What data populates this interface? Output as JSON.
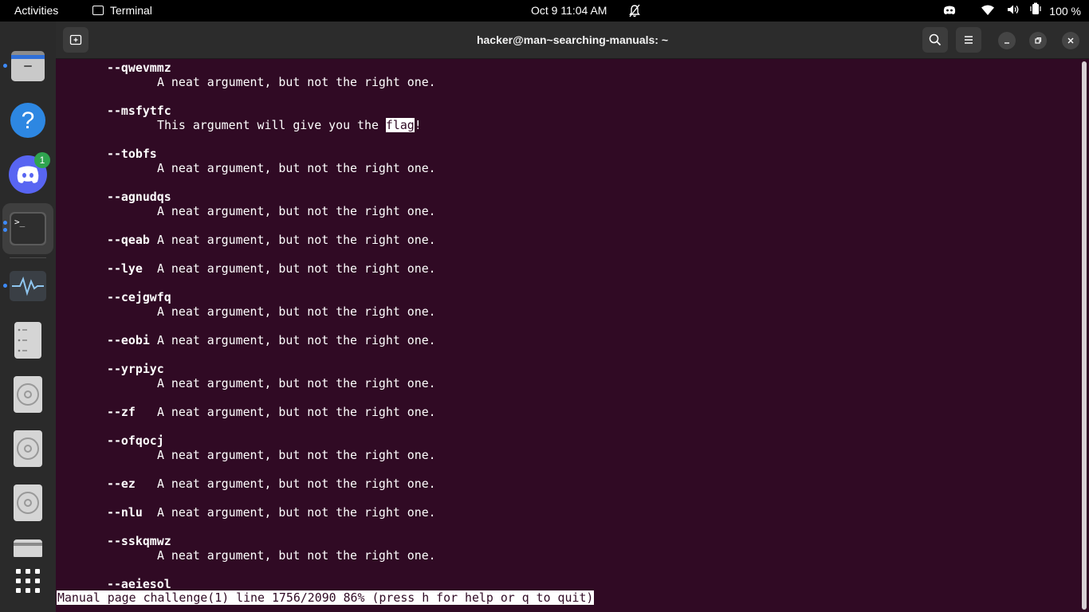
{
  "topbar": {
    "activities": "Activities",
    "app_name": "Terminal",
    "clock": "Oct 9  11:04 AM",
    "battery": "100 %"
  },
  "dock": {
    "apps": [
      {
        "name": "files",
        "icon": "folder-icon",
        "running": true
      },
      {
        "name": "help",
        "icon": "help-icon",
        "running": false
      },
      {
        "name": "discord",
        "icon": "discord-icon",
        "running": false,
        "badge": "1"
      },
      {
        "name": "terminal",
        "icon": "terminal-icon",
        "running": true,
        "active": true
      },
      {
        "name": "system-monitor",
        "icon": "system-monitor-icon",
        "running": true
      },
      {
        "name": "drive",
        "icon": "drive-icon",
        "running": false
      },
      {
        "name": "disc-1",
        "icon": "disc-icon",
        "running": false
      },
      {
        "name": "disc-2",
        "icon": "disc-icon",
        "running": false
      },
      {
        "name": "disc-3",
        "icon": "disc-icon",
        "running": false
      },
      {
        "name": "printer",
        "icon": "printer-icon",
        "running": false
      },
      {
        "name": "show-apps",
        "icon": "apps-grid-icon",
        "running": false
      }
    ]
  },
  "window": {
    "title": "hacker@man~searching-manuals: ~"
  },
  "terminal": {
    "lines": [
      {
        "kind": "opt",
        "text": "--qwevmmz"
      },
      {
        "kind": "desc",
        "text": "A neat argument, but not the right one."
      },
      {
        "kind": "opt",
        "text": "--msfytfc"
      },
      {
        "kind": "desc_flag",
        "pre": "This argument will give you the ",
        "hl": "flag",
        "post": "!"
      },
      {
        "kind": "opt",
        "text": "--tobfs"
      },
      {
        "kind": "desc",
        "text": "A neat argument, but not the right one."
      },
      {
        "kind": "opt",
        "text": "--agnudqs"
      },
      {
        "kind": "desc",
        "text": "A neat argument, but not the right one."
      },
      {
        "kind": "inline",
        "opt": "--qeab",
        "desc": "A neat argument, but not the right one."
      },
      {
        "kind": "inline",
        "opt": "--lye",
        "desc": "A neat argument, but not the right one."
      },
      {
        "kind": "opt",
        "text": "--cejgwfq"
      },
      {
        "kind": "desc",
        "text": "A neat argument, but not the right one."
      },
      {
        "kind": "inline",
        "opt": "--eobi",
        "desc": "A neat argument, but not the right one."
      },
      {
        "kind": "opt",
        "text": "--yrpiyc"
      },
      {
        "kind": "desc",
        "text": "A neat argument, but not the right one."
      },
      {
        "kind": "inline",
        "opt": "--zf",
        "desc": "A neat argument, but not the right one."
      },
      {
        "kind": "opt",
        "text": "--ofqocj"
      },
      {
        "kind": "desc",
        "text": "A neat argument, but not the right one."
      },
      {
        "kind": "inline",
        "opt": "--ez",
        "desc": "A neat argument, but not the right one."
      },
      {
        "kind": "inline",
        "opt": "--nlu",
        "desc": "A neat argument, but not the right one."
      },
      {
        "kind": "opt",
        "text": "--sskqmwz"
      },
      {
        "kind": "desc",
        "text": "A neat argument, but not the right one."
      },
      {
        "kind": "opt",
        "text": "--aeiesol"
      }
    ],
    "status": "Manual page challenge(1) line 1756/2090 86% (press h for help or q to quit)"
  },
  "colors": {
    "terminal_bg": "#300a24",
    "accent": "#3d8bfd"
  }
}
